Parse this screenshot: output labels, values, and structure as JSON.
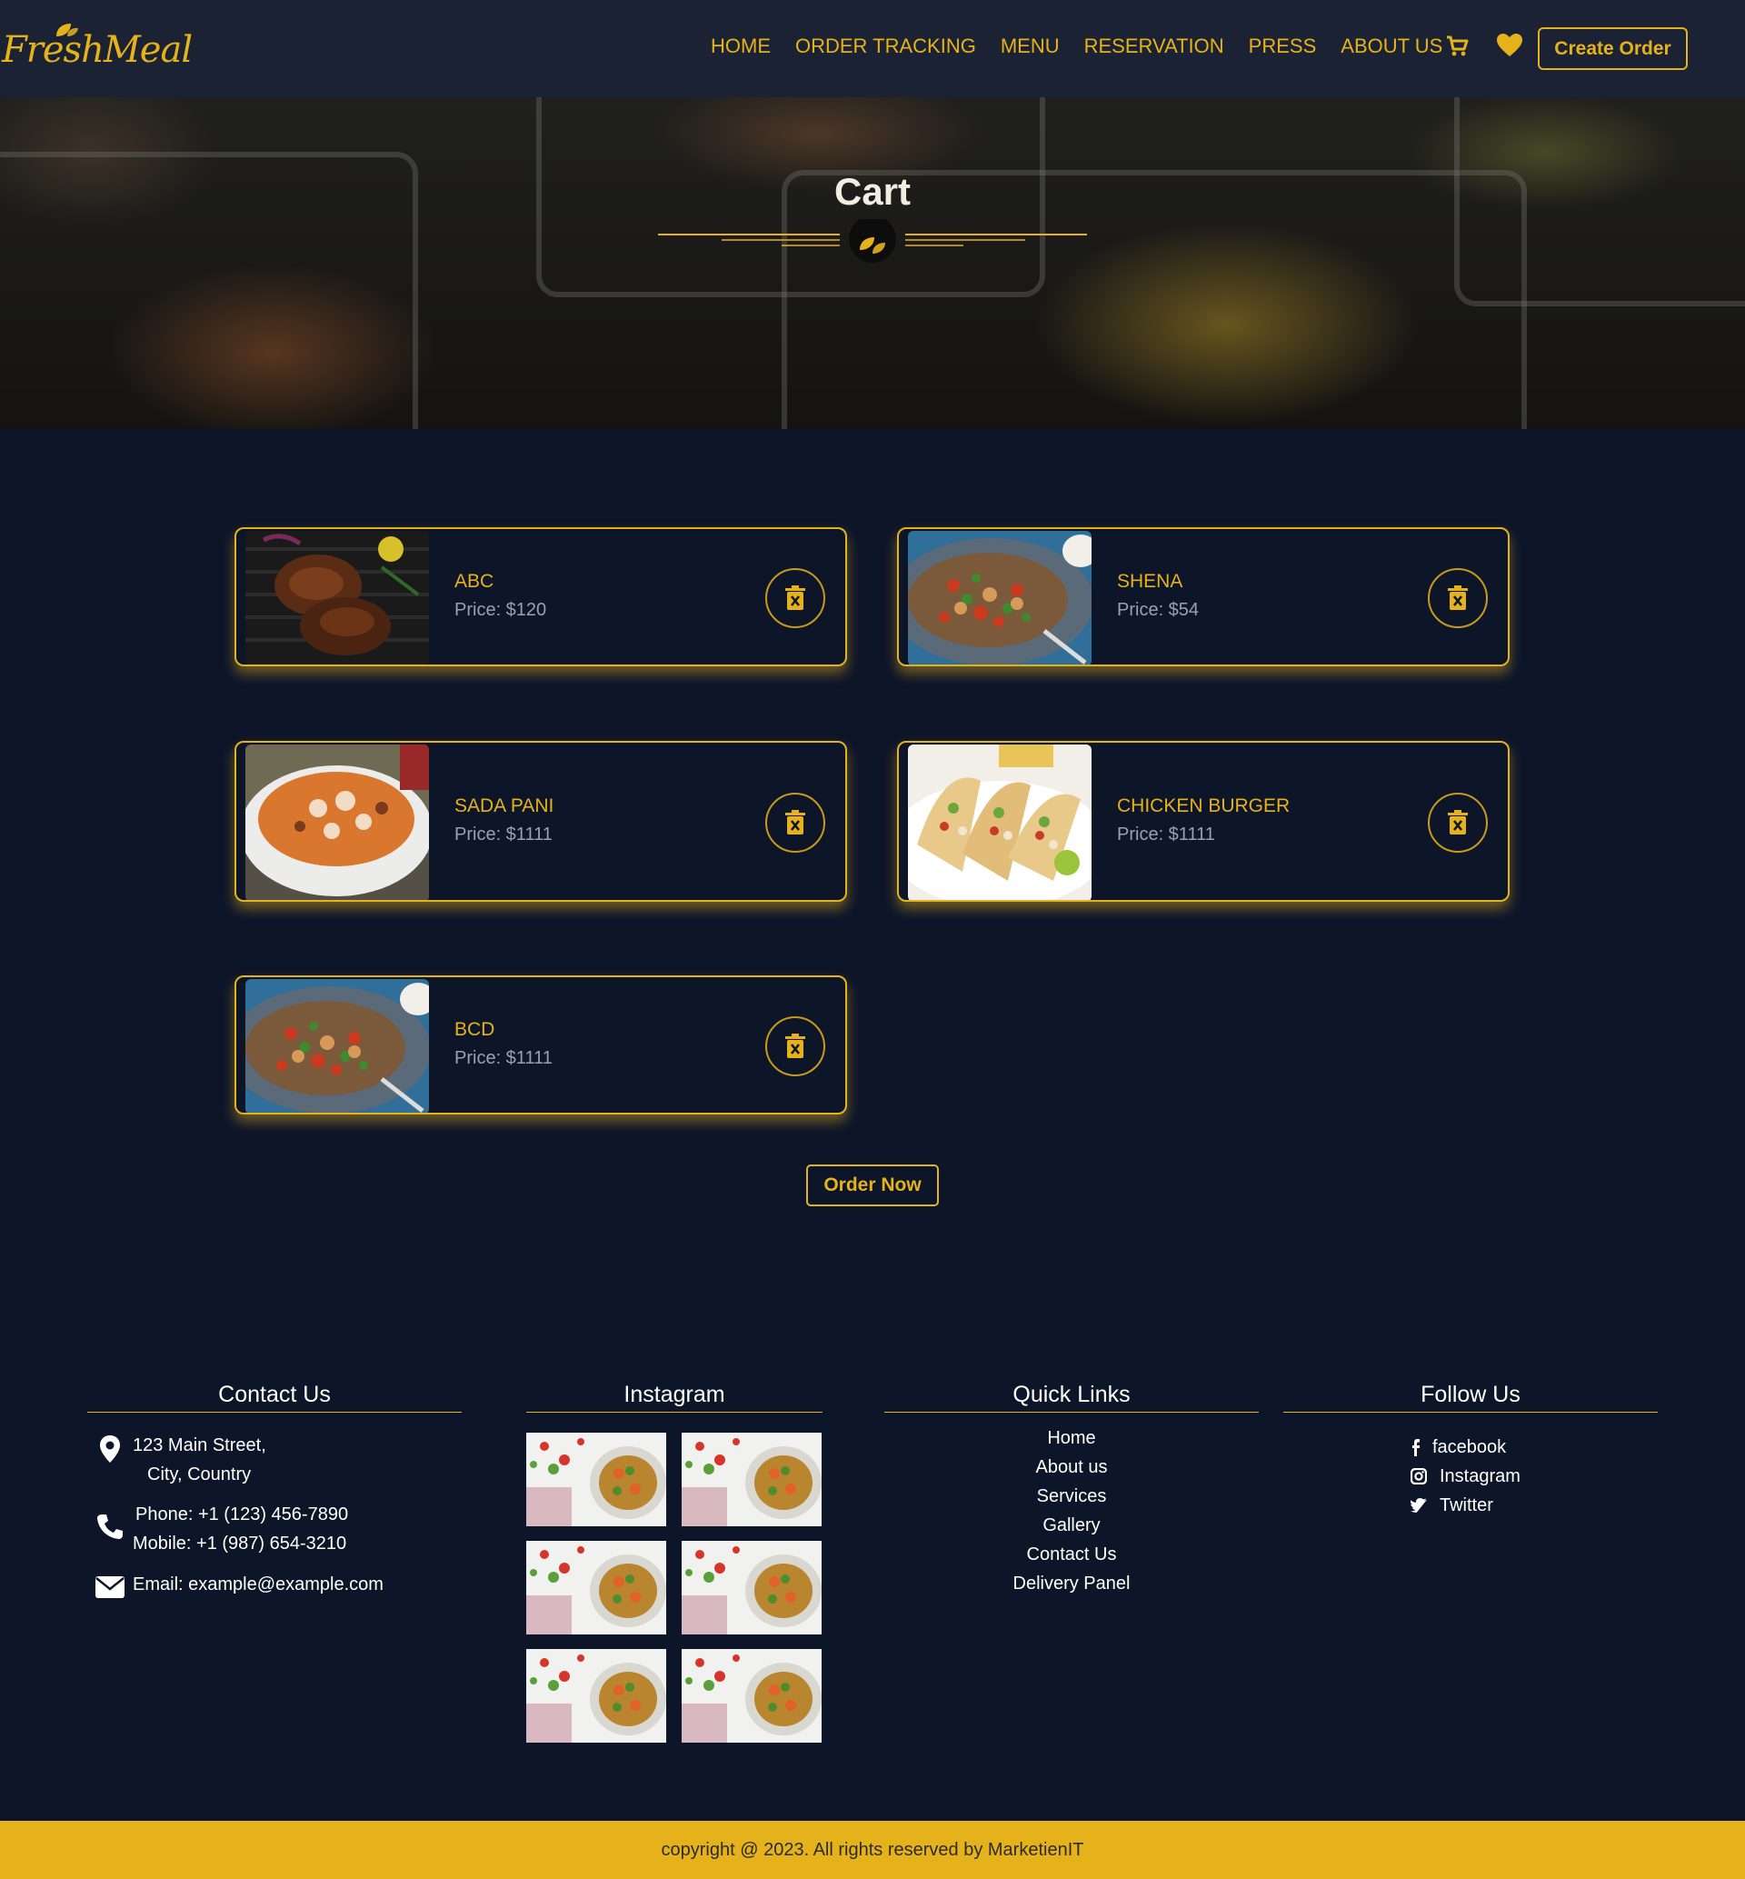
{
  "brand": {
    "logo_text": "FreshMeal",
    "accent": "#e6b21b",
    "background": "#0d1529",
    "nav_background": "#1b2233"
  },
  "nav": {
    "links": [
      "HOME",
      "ORDER TRACKING",
      "MENU",
      "RESERVATION",
      "PRESS",
      "ABOUT US"
    ],
    "cart_icon": "cart-icon",
    "wishlist_icon": "heart-icon",
    "create_order": "Create Order"
  },
  "hero": {
    "title": "Cart"
  },
  "cart": {
    "items": [
      {
        "name": "ABC",
        "price": "Price: $120",
        "image": "grilled-chicken",
        "delete_icon": "trash-icon"
      },
      {
        "name": "SHENA",
        "price": "Price: $54",
        "image": "stir-fry-plate",
        "delete_icon": "trash-icon"
      },
      {
        "name": "SADA PANI",
        "price": "Price: $1111",
        "image": "soup-bowl",
        "delete_icon": "trash-icon"
      },
      {
        "name": "CHICKEN BURGER",
        "price": "Price: $1111",
        "image": "tacos-plate",
        "delete_icon": "trash-icon"
      },
      {
        "name": "BCD",
        "price": "Price: $1111",
        "image": "stir-fry-plate",
        "delete_icon": "trash-icon"
      }
    ],
    "order_button": "Order Now"
  },
  "footer": {
    "contact": {
      "title": "Contact Us",
      "address_line1": "123 Main Street,",
      "address_line2": "City, Country",
      "phone": "Phone: +1 (123) 456-7890",
      "mobile": "Mobile: +1 (987) 654-3210",
      "email": "Email: example@example.com"
    },
    "instagram": {
      "title": "Instagram",
      "tile_count": 6
    },
    "quick_links": {
      "title": "Quick Links",
      "links": [
        "Home",
        "About us",
        "Services",
        "Gallery",
        "Contact Us",
        "Delivery Panel"
      ]
    },
    "follow": {
      "title": "Follow Us",
      "links": [
        "facebook",
        "Instagram",
        "Twitter"
      ]
    },
    "copyright": "copyright @ 2023. All rights reserved by MarketienIT"
  }
}
